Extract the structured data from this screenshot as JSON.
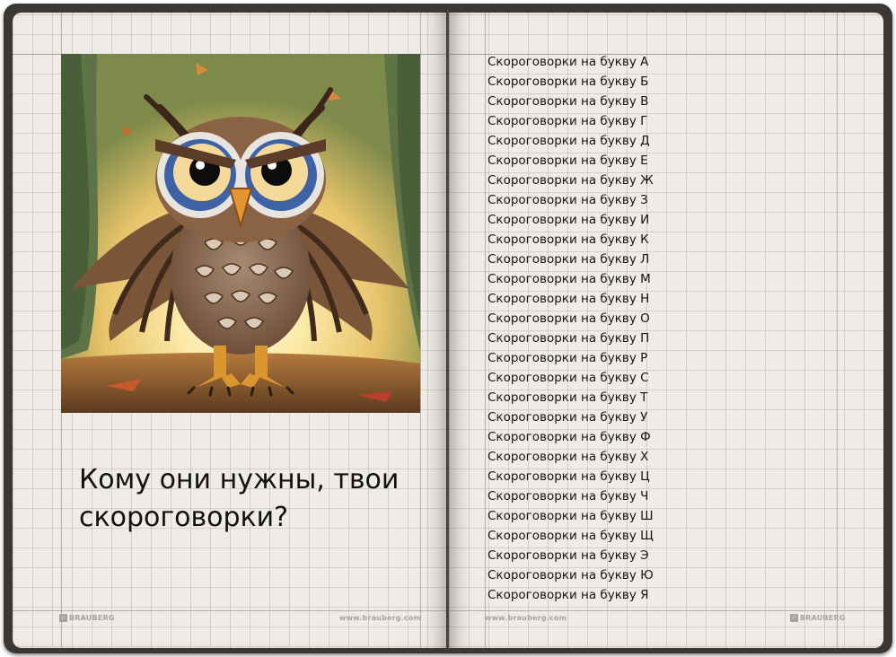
{
  "left_page": {
    "heading": "Кому они нужны, твои скороговорки?",
    "footer_brand": "BRAUBERG",
    "footer_url": "www.brauberg.com"
  },
  "right_page": {
    "footer_url": "www.brauberg.com",
    "footer_brand": "BRAUBERG",
    "topics": [
      "Скороговорки на букву А",
      "Скороговорки на букву Б",
      "Скороговорки на букву В",
      "Скороговорки на букву Г",
      "Скороговорки на букву Д",
      "Скороговорки на букву Е",
      "Скороговорки на букву Ж",
      "Скороговорки на букву З",
      "Скороговорки на букву И",
      "Скороговорки на букву К",
      "Скороговорки на букву Л",
      "Скороговорки на букву М",
      "Скороговорки на букву Н",
      "Скороговорки на букву О",
      "Скороговорки на букву П",
      "Скороговорки на букву Р",
      "Скороговорки на букву С",
      "Скороговорки на букву Т",
      "Скороговорки на букву У",
      "Скороговорки на букву Ф",
      "Скороговорки на букву Х",
      "Скороговорки на букву Ц",
      "Скороговорки на букву Ч",
      "Скороговорки на букву Ш",
      "Скороговорки на букву Щ",
      "Скороговорки на букву Э",
      "Скороговорки на букву Ю",
      "Скороговорки на букву Я"
    ]
  },
  "illustration": {
    "subject": "owl-illustration"
  },
  "colors": {
    "cover": "#3b3734",
    "paper": "#efebe6",
    "text": "#141414"
  }
}
